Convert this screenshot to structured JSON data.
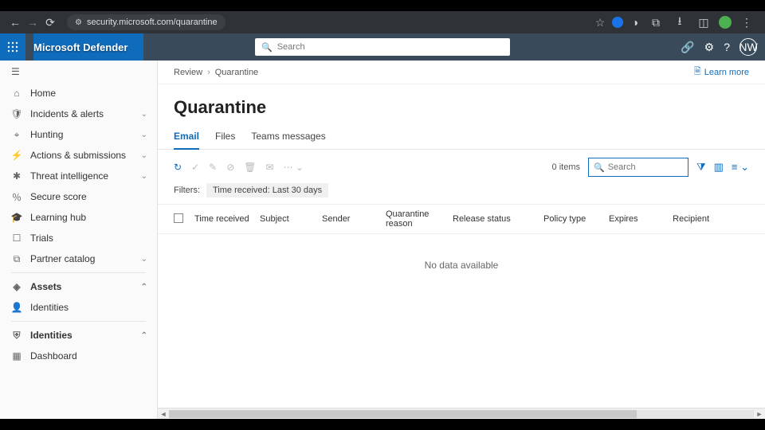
{
  "browser": {
    "url_display": "security.microsoft.com/quarantine"
  },
  "product_name": "Microsoft Defender",
  "top_search_placeholder": "Search",
  "top_avatar_initials": "NW",
  "sidebar": {
    "items": [
      {
        "icon": "home",
        "label": "Home",
        "chev": ""
      },
      {
        "icon": "shield",
        "label": "Incidents & alerts",
        "chev": "v"
      },
      {
        "icon": "hunt",
        "label": "Hunting",
        "chev": "v"
      },
      {
        "icon": "actions",
        "label": "Actions & submissions",
        "chev": "v"
      },
      {
        "icon": "threat",
        "label": "Threat intelligence",
        "chev": "v"
      },
      {
        "icon": "score",
        "label": "Secure score",
        "chev": ""
      },
      {
        "icon": "learn",
        "label": "Learning hub",
        "chev": ""
      },
      {
        "icon": "trials",
        "label": "Trials",
        "chev": ""
      },
      {
        "icon": "partner",
        "label": "Partner catalog",
        "chev": "v"
      }
    ],
    "group1_label": "Assets",
    "group1_items": [
      {
        "icon": "identity",
        "label": "Identities"
      }
    ],
    "group2_label": "Identities",
    "group2_items": [
      {
        "icon": "dash",
        "label": "Dashboard"
      }
    ]
  },
  "breadcrumb": {
    "root": "Review",
    "leaf": "Quarantine"
  },
  "learn_more": "Learn more",
  "page_title": "Quarantine",
  "tabs": {
    "email": "Email",
    "files": "Files",
    "teams": "Teams messages"
  },
  "toolbar": {
    "items_count": "0 items",
    "search_placeholder": "Search"
  },
  "filters_label": "Filters:",
  "filter_pill_key": "Time received: ",
  "filter_pill_val": "Last 30 days",
  "columns": {
    "time": "Time received",
    "subject": "Subject",
    "sender": "Sender",
    "reason": "Quarantine reason",
    "release": "Release status",
    "policy": "Policy type",
    "expires": "Expires",
    "recipient": "Recipient"
  },
  "empty_message": "No data available"
}
